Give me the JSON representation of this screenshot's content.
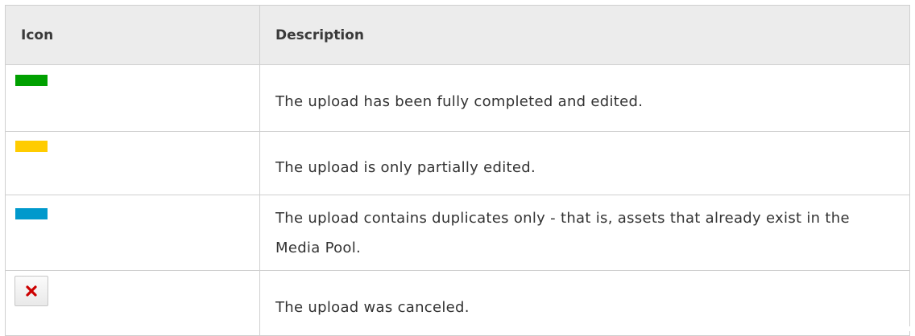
{
  "table": {
    "headers": {
      "icon": "Icon",
      "description": "Description"
    },
    "rows": [
      {
        "icon": "green-bar-icon",
        "color": "#00a000",
        "description": "The upload has been fully completed and edited."
      },
      {
        "icon": "yellow-bar-icon",
        "color": "#ffcc00",
        "description": "The upload is only partially edited."
      },
      {
        "icon": "blue-bar-icon",
        "color": "#0099cc",
        "description": "The upload contains duplicates only - that is, assets that already exist in the Media Pool."
      },
      {
        "icon": "red-x-cancel-icon",
        "color": "#cc0000",
        "description": "The upload was canceled."
      }
    ]
  }
}
